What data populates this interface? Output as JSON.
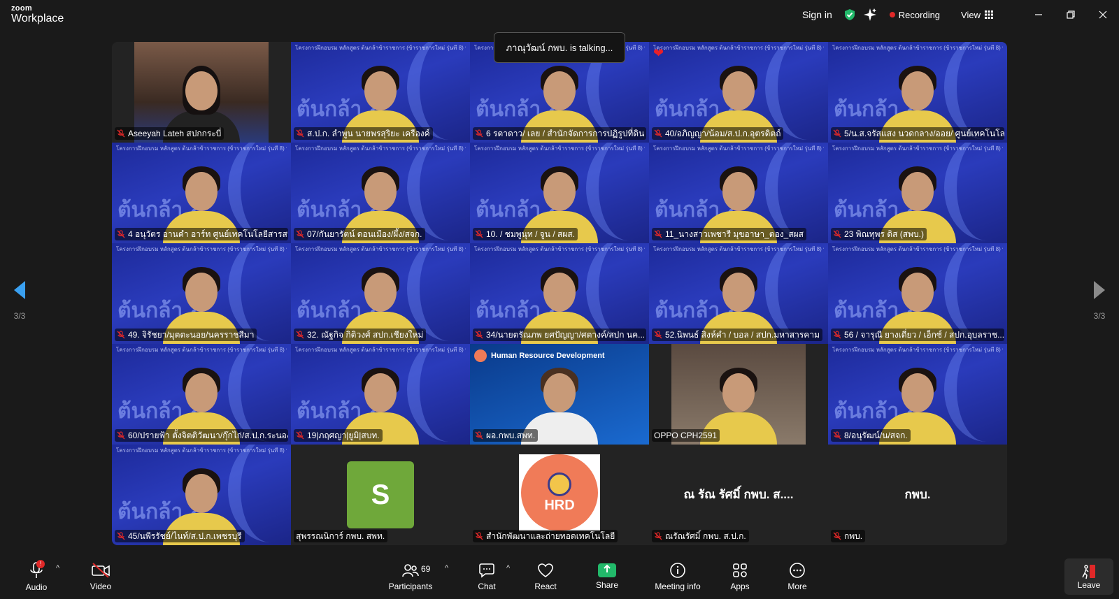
{
  "app": {
    "brand_top": "zoom",
    "brand_bottom": "Workplace"
  },
  "titlebar": {
    "signin": "Sign in",
    "recording": "Recording",
    "view": "View",
    "colors": {
      "shield": "#22b96a",
      "record": "#e02828"
    }
  },
  "toast": {
    "text": "ภาณุวัฒน์ กพบ. is talking..."
  },
  "nav": {
    "left_page": "3/3",
    "right_page": "3/3",
    "left_arrow_color": "#3aa0f0"
  },
  "participants": [
    {
      "name": "Aseeyah Lateh สปกกระบี่",
      "muted": true
    },
    {
      "name": "ส.ป.ก. ลำพูน นายพรสุริยะ เครืองค์",
      "muted": true
    },
    {
      "name": "6 รดาดาว/ เลย / สำนักจัดการการปฏิรูปที่ดิน",
      "muted": true
    },
    {
      "name": "40/อภิญญา/น้อม/ส.ป.ก.อุตรดิตถ์",
      "muted": true
    },
    {
      "name": "5/น.ส.จรัสแสง นวดกลาง/ออย/ ศูนย์เทคโนโลยี...",
      "muted": true
    },
    {
      "name": "4 อนุวัตร อานคำ อาร์ท ศูนย์เทคโนโลยีสารสนเ...",
      "muted": true
    },
    {
      "name": "07/กันยารัตน์ ดอนเมือง/ผึ้ง/สจก.",
      "muted": true
    },
    {
      "name": "10. / ชมพูนุท / จูน / สผส.",
      "muted": true
    },
    {
      "name": "11_นางสาวเพชารี มุขอาษา_ตอง_สผส",
      "muted": true
    },
    {
      "name": "23 พิณทุพร ดิส (สพบ.)",
      "muted": true
    },
    {
      "name": "49. จิรัชยา/มุตตะนอย/นครราชสีมา",
      "muted": true
    },
    {
      "name": "32. ณัฐกิจ กิติวงศ์ สปก.เชียงใหม่",
      "muted": true
    },
    {
      "name": "34/นายตรัณภพ ยศปัญญา/ศตางค์/สปก นค...",
      "muted": true
    },
    {
      "name": "52.นิพนธ์ สิงห์คำ / บอล / สปก.มหาสารคาม",
      "muted": true
    },
    {
      "name": "56 / จารุณี ยางเดี่ยว / เอ็กซ์ / สปก.อุบลราช...",
      "muted": true
    },
    {
      "name": "60/ปรายฟ้า ตั้งจิตติวัฒนา/กุ๊กไก่/ส.ป.ก.ระนอง",
      "muted": true
    },
    {
      "name": "19|ภฤศญา|ยูมิ|สบท.",
      "muted": true
    },
    {
      "name": "ผอ.กพบ.สพท.",
      "muted": true
    },
    {
      "name": "OPPO CPH2591",
      "muted": false
    },
    {
      "name": "8/อนุรัฒน์/น/สจก.",
      "muted": true
    },
    {
      "name": "45/นพีรรัชย์/ไนท์/ส.ป.ก.เพชรบุรี",
      "muted": true
    },
    {
      "name": "สุพรรณนิการ์ กพบ. สพท.",
      "muted": false,
      "avatar_letter": "S",
      "avatar_color": "#6fa83a"
    },
    {
      "name": "สำนักพัฒนาและถ่ายทอดเทคโนโลยี",
      "muted": true,
      "logo_text": "HRD"
    },
    {
      "name": "ณรัณรัศมิ์ กพบ. ส.ป.ก.",
      "muted": true,
      "display_name": "ณ รัณ รัศมิ์ กพบ. ส...."
    },
    {
      "name": "กพบ.",
      "muted": true,
      "display_name": "กพบ."
    }
  ],
  "hrd_banner": "Human Resource Development",
  "background_caption": "โครงการฝึกอบรม หลักสูตร ต้นกล้าข้าราชการ (ข้าราชการใหม่ รุ่นที่ 8) ประจำปีงบประมาณ พ.ศ. 2568",
  "background_big": "ต้นกล้า 8",
  "toolbar": {
    "audio": "Audio",
    "audio_badge": "!",
    "video": "Video",
    "participants": "Participants",
    "participants_count": "69",
    "chat": "Chat",
    "react": "React",
    "share": "Share",
    "meeting_info": "Meeting info",
    "apps": "Apps",
    "more": "More",
    "leave": "Leave",
    "colors": {
      "share": "#22b96a",
      "video_off": "#e02828"
    }
  }
}
